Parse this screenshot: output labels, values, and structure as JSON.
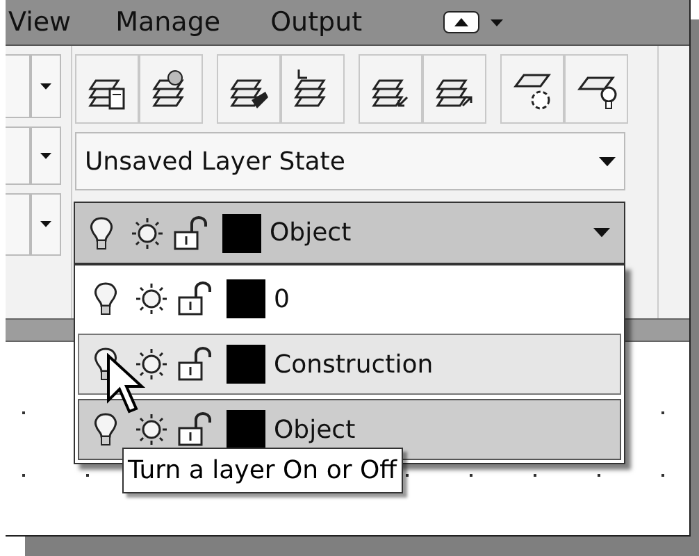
{
  "tabs": [
    {
      "label": "View"
    },
    {
      "label": "Manage"
    },
    {
      "label": "Output"
    }
  ],
  "layer_state": {
    "value": "Unsaved Layer State"
  },
  "current_layer": {
    "name": "Object"
  },
  "layer_list": [
    {
      "name": "0",
      "selected": false,
      "hovered": false
    },
    {
      "name": "Construction",
      "selected": false,
      "hovered": true
    },
    {
      "name": "Object",
      "selected": true,
      "hovered": false
    }
  ],
  "tooltip": "Turn a layer On or Off"
}
